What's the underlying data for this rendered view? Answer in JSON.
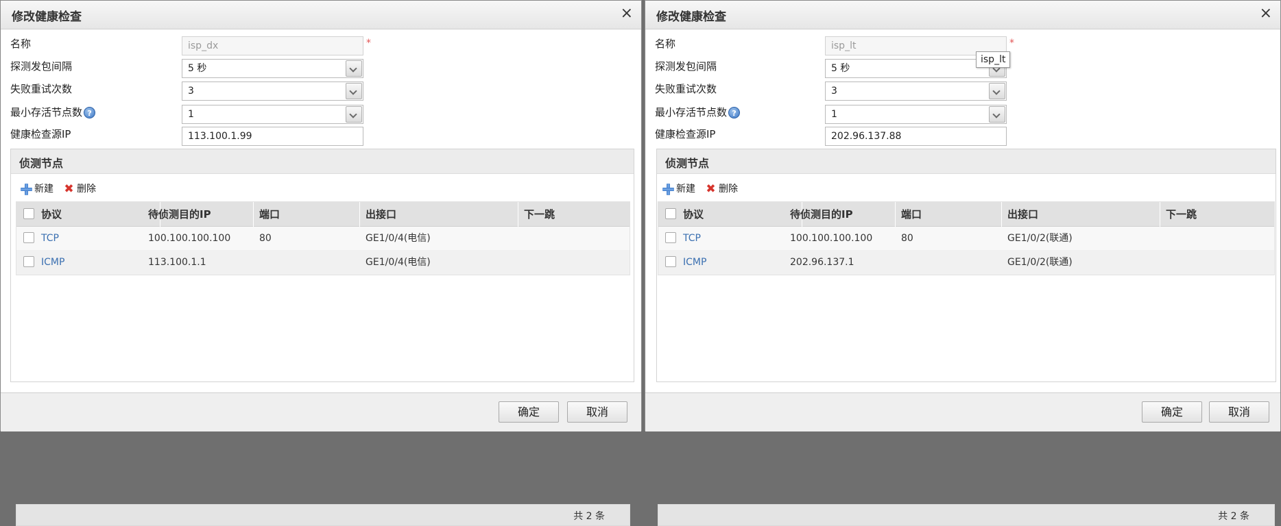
{
  "dialogs": [
    {
      "title": "修改健康检查",
      "close_glyph": "×",
      "form": {
        "name_label": "名称",
        "name_value": "isp_dx",
        "required_mark": "*",
        "interval_label": "探测发包间隔",
        "interval_value": "5 秒",
        "retry_label": "失败重试次数",
        "retry_value": "3",
        "min_alive_label": "最小存活节点数",
        "help_glyph": "?",
        "min_alive_value": "1",
        "src_ip_label": "健康检查源IP",
        "src_ip_value": "113.100.1.99"
      },
      "panel": {
        "title": "侦测节点",
        "new_label": "新建",
        "delete_label": "删除",
        "delete_glyph": "✖",
        "columns": [
          "协议",
          "待侦测目的IP",
          "端口",
          "出接口",
          "下一跳"
        ],
        "rows": [
          {
            "protocol": "TCP",
            "ip": "100.100.100.100",
            "port": "80",
            "iface": "GE1/0/4(电信)",
            "nexthop": ""
          },
          {
            "protocol": "ICMP",
            "ip": "113.100.1.1",
            "port": "",
            "iface": "GE1/0/4(电信)",
            "nexthop": ""
          }
        ],
        "total": "共 2 条"
      },
      "ok_label": "确定",
      "cancel_label": "取消"
    },
    {
      "title": "修改健康检查",
      "close_glyph": "×",
      "form": {
        "name_label": "名称",
        "name_value": "isp_lt",
        "required_mark": "*",
        "interval_label": "探测发包间隔",
        "interval_value": "5 秒",
        "retry_label": "失败重试次数",
        "retry_value": "3",
        "min_alive_label": "最小存活节点数",
        "help_glyph": "?",
        "min_alive_value": "1",
        "src_ip_label": "健康检查源IP",
        "src_ip_value": "202.96.137.88"
      },
      "tooltip": "isp_lt",
      "panel": {
        "title": "侦测节点",
        "new_label": "新建",
        "delete_label": "删除",
        "delete_glyph": "✖",
        "columns": [
          "协议",
          "待侦测目的IP",
          "端口",
          "出接口",
          "下一跳"
        ],
        "rows": [
          {
            "protocol": "TCP",
            "ip": "100.100.100.100",
            "port": "80",
            "iface": "GE1/0/2(联通)",
            "nexthop": ""
          },
          {
            "protocol": "ICMP",
            "ip": "202.96.137.1",
            "port": "",
            "iface": "GE1/0/2(联通)",
            "nexthop": ""
          }
        ],
        "total": "共 2 条"
      },
      "ok_label": "确定",
      "cancel_label": "取消"
    }
  ],
  "colors": {
    "link": "#3a6fb0",
    "required": "#e25555",
    "header_bg": "#e1e1e1"
  }
}
